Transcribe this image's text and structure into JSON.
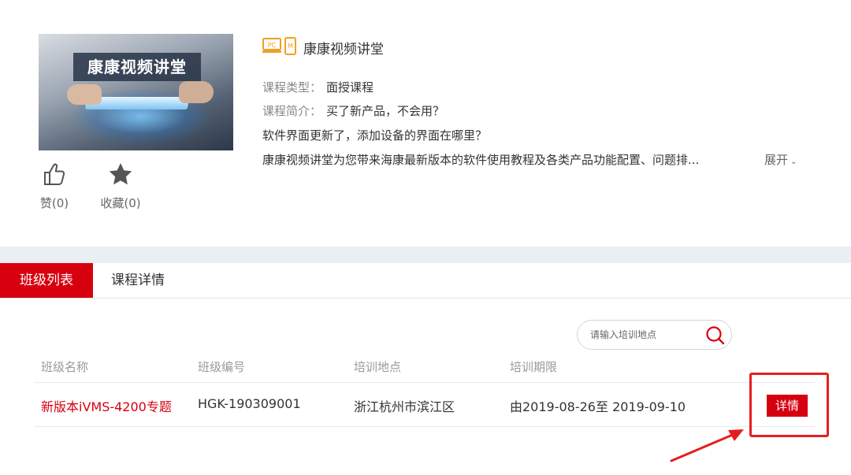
{
  "course": {
    "thumbnail_text": "康康视频讲堂",
    "platform_icons": [
      "pc-icon",
      "mobile-icon"
    ],
    "platform_labels": {
      "pc": "PC",
      "mobile": "M"
    },
    "title": "康康视频讲堂",
    "type_label": "课程类型：",
    "type_value": "面授课程",
    "intro_label": "课程简介：",
    "intro_line1": "买了新产品，不会用？",
    "intro_line2": "软件界面更新了，添加设备的界面在哪里？",
    "intro_line3": "康康视频讲堂为您带来海康最新版本的软件使用教程及各类产品功能配置、问题排...",
    "expand_label": "展开"
  },
  "actions": {
    "like_label": "赞(0)",
    "favorite_label": "收藏(0)"
  },
  "tabs": [
    {
      "label": "班级列表",
      "active": true
    },
    {
      "label": "课程详情",
      "active": false
    }
  ],
  "search": {
    "placeholder": "请输入培训地点",
    "value": ""
  },
  "table": {
    "headers": [
      "班级名称",
      "班级编号",
      "培训地点",
      "培训期限"
    ],
    "rows": [
      {
        "name": "新版本iVMS-4200专题",
        "code": "HGK-190309001",
        "location": "浙江杭州市滨江区",
        "period": "由2019-08-26至 2019-09-10",
        "action_label": "详情"
      }
    ]
  },
  "colors": {
    "brand_red": "#d7000f",
    "annotation_red": "#e61e1e",
    "band_gray": "#ebeef2"
  }
}
